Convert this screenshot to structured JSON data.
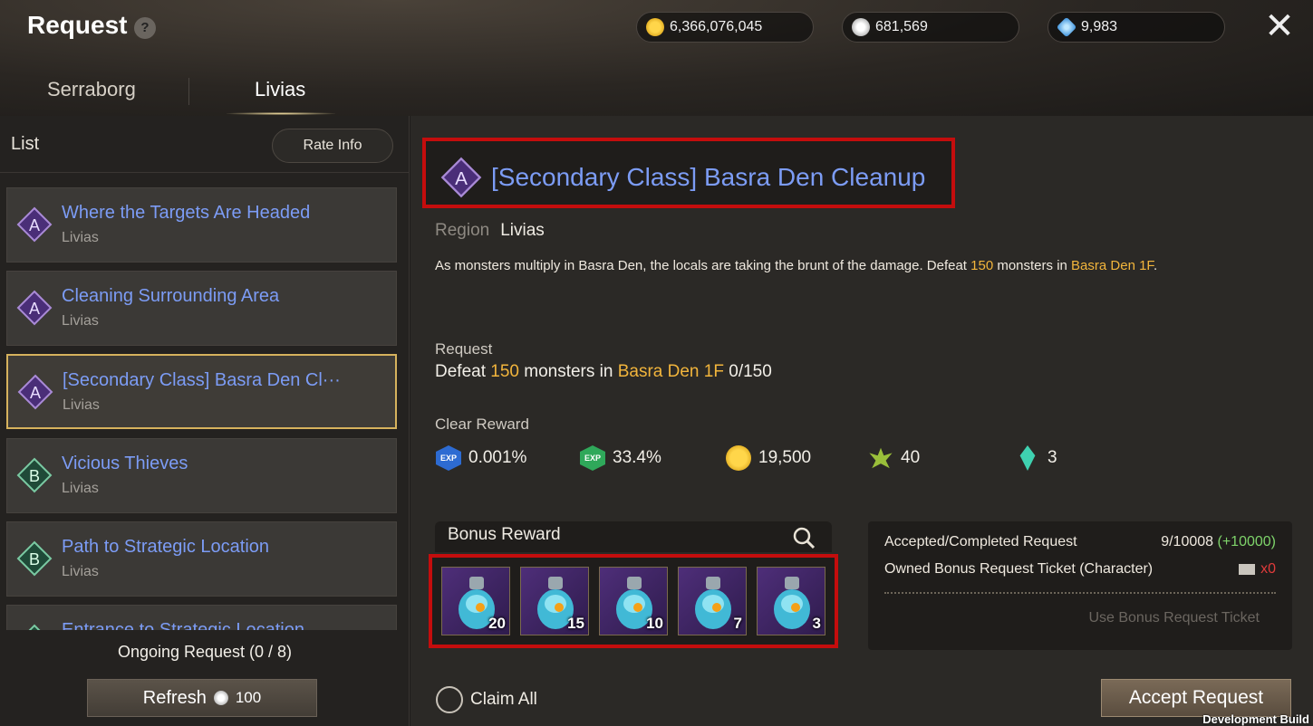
{
  "header": {
    "title": "Request",
    "help_label": "?",
    "close_label": "✕",
    "currencies": [
      {
        "name": "gold-icon",
        "value": "6,366,076,045",
        "color": "#f2b800"
      },
      {
        "name": "feather-icon",
        "value": "681,569",
        "color": "#cfcfcf"
      },
      {
        "name": "diamond-icon",
        "value": "9,983",
        "color": "#58b8f5"
      }
    ],
    "tabs": [
      {
        "label": "Serraborg",
        "active": false
      },
      {
        "label": "Livias",
        "active": true
      }
    ]
  },
  "list": {
    "label": "List",
    "rate_info": "Rate Info",
    "items": [
      {
        "grade": "A",
        "title": "Where the Targets Are Headed",
        "region": "Livias",
        "selected": false
      },
      {
        "grade": "A",
        "title": "Cleaning Surrounding Area",
        "region": "Livias",
        "selected": false
      },
      {
        "grade": "A",
        "title": "[Secondary Class] Basra Den Cl···",
        "region": "Livias",
        "selected": true
      },
      {
        "grade": "B",
        "title": "Vicious Thieves",
        "region": "Livias",
        "selected": false
      },
      {
        "grade": "B",
        "title": "Path to Strategic Location",
        "region": "Livias",
        "selected": false
      },
      {
        "grade": "B",
        "title": "Entrance to Strategic Location",
        "region": "",
        "selected": false
      }
    ],
    "ongoing": "Ongoing Request (0 / 8)",
    "refresh_label": "Refresh",
    "refresh_cost": "100"
  },
  "detail": {
    "grade": "A",
    "title": "[Secondary Class] Basra Den Cleanup",
    "region_label": "Region",
    "region_value": "Livias",
    "description": {
      "p1": "As monsters multiply in Basra Den, the locals are taking the brunt of the damage. Defeat ",
      "count": "150",
      "p2": " monsters in ",
      "place": "Basra Den 1F",
      "p3": "."
    },
    "request_label": "Request",
    "request": {
      "p1": "Defeat ",
      "count": "150",
      "p2": " monsters in ",
      "place": "Basra Den 1F",
      "progress": " 0/150"
    },
    "clear_reward_label": "Clear Reward",
    "rewards": [
      {
        "icon": "exp-blue-icon",
        "value": "0.001%"
      },
      {
        "icon": "exp-green-icon",
        "value": "33.4%"
      },
      {
        "icon": "gold-coin-icon",
        "value": "19,500"
      },
      {
        "icon": "leaf-emblem-icon",
        "value": "40"
      },
      {
        "icon": "crystal-icon",
        "value": "3"
      }
    ],
    "bonus_reward_label": "Bonus Reward",
    "bonus_slots": [
      {
        "count": "20"
      },
      {
        "count": "15"
      },
      {
        "count": "10"
      },
      {
        "count": "7"
      },
      {
        "count": "3"
      }
    ],
    "info": {
      "accepted_label": "Accepted/Completed Request",
      "accepted_value": "9/10008",
      "accepted_extra": "(+10000)",
      "ticket_label": "Owned Bonus Request Ticket (Character)",
      "ticket_value": "x0",
      "use_ticket": "Use Bonus Request Ticket"
    },
    "claim_all": "Claim All",
    "accept": "Accept Request"
  },
  "footer": {
    "dev_build": "Development Build"
  }
}
